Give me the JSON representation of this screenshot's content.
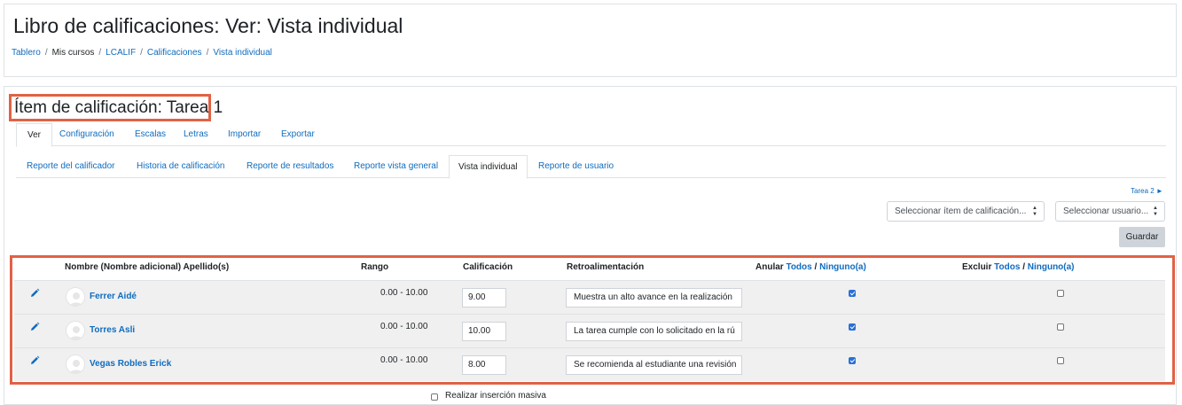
{
  "header": {
    "title": "Libro de calificaciones: Ver: Vista individual",
    "breadcrumb": [
      "Tablero",
      "Mis cursos",
      "LCALIF",
      "Calificaciones",
      "Vista individual"
    ]
  },
  "main": {
    "item_heading": "Ítem de calificación: Tarea 1",
    "tabs_primary": [
      "Ver",
      "Configuración",
      "Escalas",
      "Letras",
      "Importar",
      "Exportar"
    ],
    "tabs_secondary": [
      "Reporte del calificador",
      "Historia de calificación",
      "Reporte de resultados",
      "Reporte vista general",
      "Vista individual",
      "Reporte de usuario"
    ],
    "next_item_link": "Tarea 2 ►",
    "select_item": "Seleccionar ítem de calificación...",
    "select_user": "Seleccionar usuario...",
    "save_label": "Guardar",
    "table": {
      "col_name": "Nombre (Nombre adicional) Apellido(s)",
      "col_range": "Rango",
      "col_grade": "Calificación",
      "col_feedback": "Retroalimentación",
      "override_label": "Anular",
      "exclude_label": "Excluir",
      "all_label": "Todos",
      "slash": "/",
      "none_label": "Ninguno(a)",
      "rows": [
        {
          "name": "Ferrer Aidé",
          "range": "0.00 - 10.00",
          "grade": "9.00",
          "feedback": "Muestra un alto avance en la realización",
          "override": true,
          "exclude": false
        },
        {
          "name": "Torres Asli",
          "range": "0.00 - 10.00",
          "grade": "10.00",
          "feedback": "La tarea cumple con lo solicitado en la rú",
          "override": true,
          "exclude": false
        },
        {
          "name": "Vegas Robles Erick",
          "range": "0.00 - 10.00",
          "grade": "8.00",
          "feedback": "Se recomienda al estudiante una revisión",
          "override": true,
          "exclude": false
        }
      ]
    },
    "bulk_insert_label": "Realizar inserción masiva"
  },
  "colors": {
    "link": "#0f6cbf",
    "highlight_border": "#e06245",
    "row_background": "#f0f0f0",
    "checkbox_checked": "#2a6fd6"
  }
}
